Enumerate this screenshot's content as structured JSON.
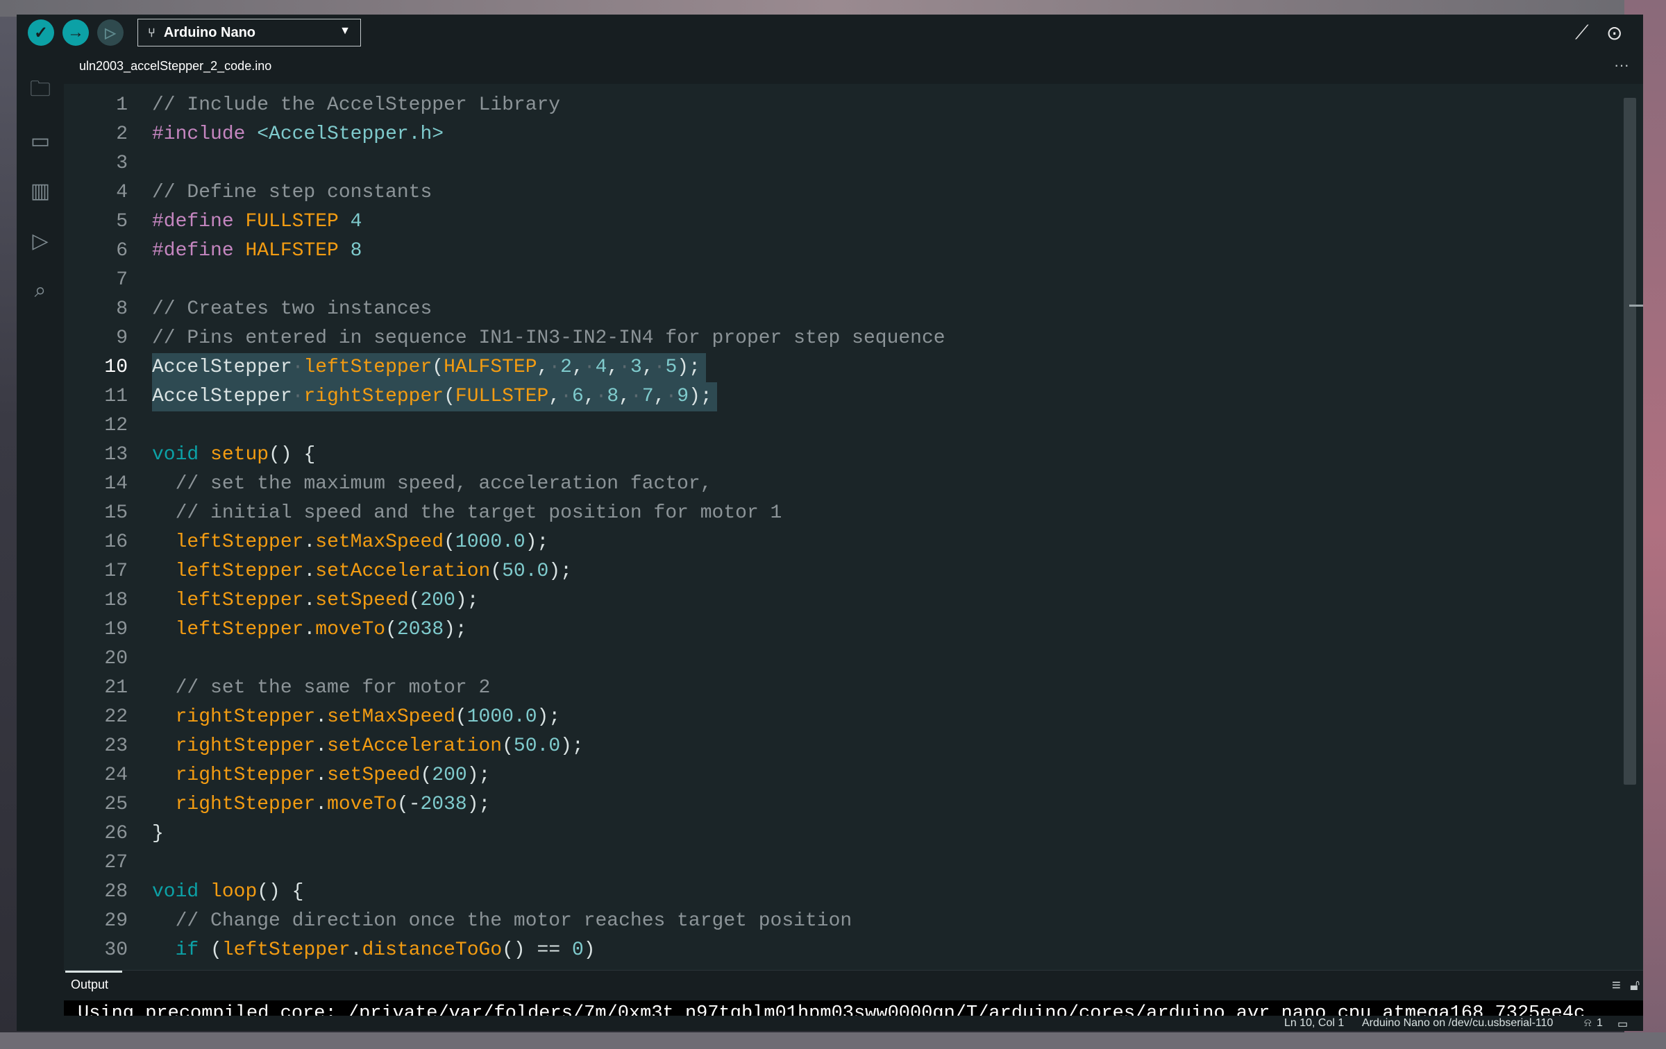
{
  "toolbar": {
    "verify_icon": "check-icon",
    "upload_icon": "arrow-right-icon",
    "debug_icon": "debug-icon",
    "board_name": "Arduino Nano",
    "plotter_icon": "serial-plotter-icon",
    "monitor_icon": "serial-monitor-icon"
  },
  "sidebar": {
    "items": [
      {
        "icon": "folder-icon",
        "label": "Sketchbook"
      },
      {
        "icon": "board-manager-icon",
        "label": "Boards Manager"
      },
      {
        "icon": "library-icon",
        "label": "Library Manager"
      },
      {
        "icon": "debug-icon",
        "label": "Debug"
      },
      {
        "icon": "search-icon",
        "label": "Search"
      }
    ]
  },
  "tabs": {
    "active": "uln2003_accelStepper_2_code.ino",
    "more": "···"
  },
  "editor": {
    "active_line": 10,
    "lines": [
      "// Include the AccelStepper Library",
      "#include <AccelStepper.h>",
      "",
      "// Define step constants",
      "#define FULLSTEP 4",
      "#define HALFSTEP 8",
      "",
      "// Creates two instances",
      "// Pins entered in sequence IN1-IN3-IN2-IN4 for proper step sequence",
      "AccelStepper·leftStepper(HALFSTEP,·2,·4,·3,·5);",
      "AccelStepper·rightStepper(FULLSTEP,·6,·8,·7,·9);",
      "",
      "void setup() {",
      "  // set the maximum speed, acceleration factor,",
      "  // initial speed and the target position for motor 1",
      "  leftStepper.setMaxSpeed(1000.0);",
      "  leftStepper.setAcceleration(50.0);",
      "  leftStepper.setSpeed(200);",
      "  leftStepper.moveTo(2038);",
      "",
      "  // set the same for motor 2",
      "  rightStepper.setMaxSpeed(1000.0);",
      "  rightStepper.setAcceleration(50.0);",
      "  rightStepper.setSpeed(200);",
      "  rightStepper.moveTo(-2038);",
      "}",
      "",
      "void loop() {",
      "  // Change direction once the motor reaches target position",
      "  if (leftStepper.distanceToGo() == 0)"
    ]
  },
  "output": {
    "title": "Output",
    "text": "Using precompiled core: /private/var/folders/7m/0xm3t_n97tgblm01hpm03sww0000gn/T/arduino/cores/arduino_avr_nano_cpu_atmega168_7325ee4c",
    "clear_icon": "clear-output-icon",
    "lock_icon": "lock-icon"
  },
  "status": {
    "cursor": "Ln 10, Col 1",
    "board_port": "Arduino Nano on /dev/cu.usbserial-110",
    "notifications": "1",
    "notification_icon": "bell-icon",
    "panel_icon": "toggle-panel-icon"
  },
  "colors": {
    "accent": "#0ca1a6",
    "editor_bg": "#1b2528",
    "chrome_bg": "#171e21",
    "selection": "#2e4a52",
    "keyword_orange": "#f39c12",
    "preprocessor": "#c586c0",
    "number": "#7fcbcd",
    "comment": "#8c9498"
  }
}
